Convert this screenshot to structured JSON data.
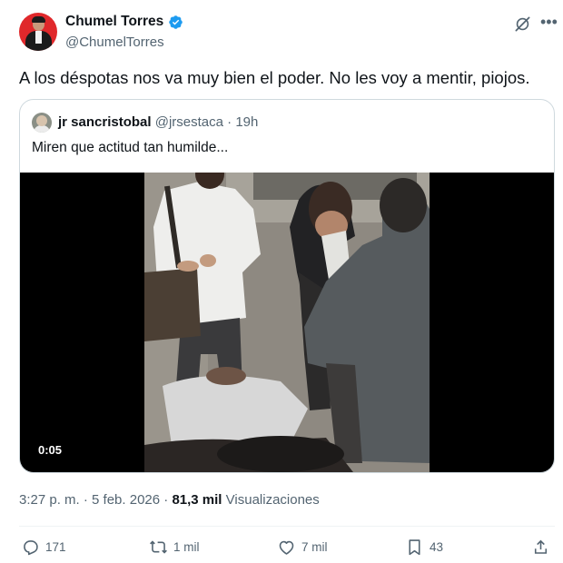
{
  "author": {
    "name": "Chumel Torres",
    "handle": "@ChumelTorres",
    "verified": true,
    "avatar_icon": "profile-avatar"
  },
  "tweet": {
    "text": "A los déspotas nos va muy bien el poder. No les voy a mentir, piojos."
  },
  "quoted": {
    "name": "jr sancristobal",
    "handle": "@jrsestaca",
    "separator": "·",
    "time": "19h",
    "text": "Miren que actitud tan humilde...",
    "video_duration": "0:05"
  },
  "meta": {
    "time_date": "3:27 p. m. · 5 feb. 2026 · ",
    "views_count": "81,3 mil",
    "views_label": "Visualizaciones"
  },
  "actions": {
    "replies": "171",
    "reposts": "1 mil",
    "likes": "7 mil",
    "bookmarks": "43"
  },
  "colors": {
    "verified": "#1d9bf0",
    "secondary_text": "#536471",
    "border": "#cfd9de"
  }
}
